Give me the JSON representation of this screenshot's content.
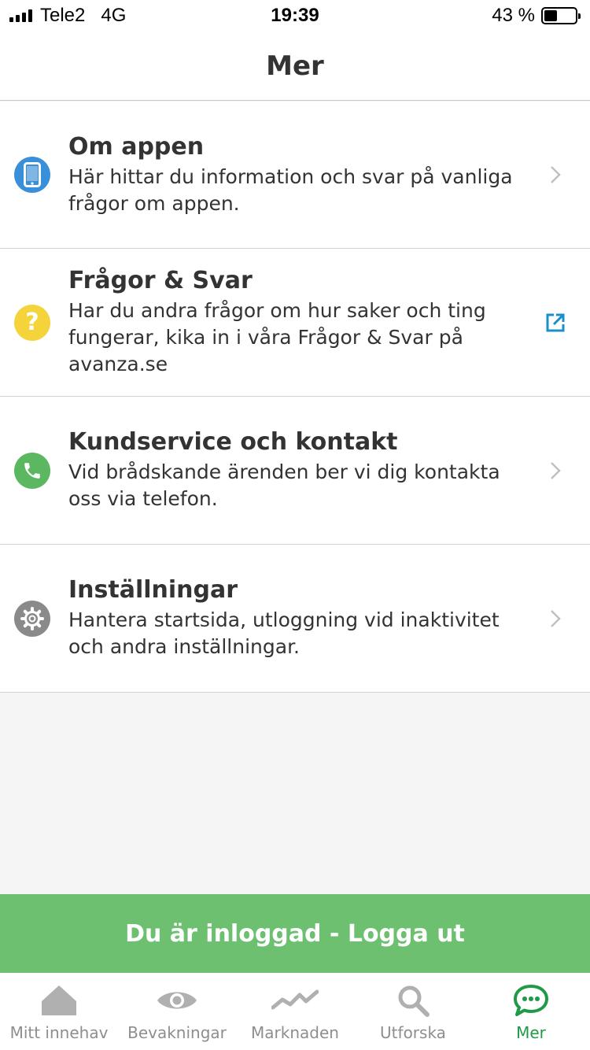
{
  "status_bar": {
    "carrier": "Tele2",
    "network": "4G",
    "time": "19:39",
    "battery_text": "43 %",
    "battery_level": 0.43
  },
  "header": {
    "title": "Mer"
  },
  "menu": {
    "items": [
      {
        "title": "Om appen",
        "description": "Här hittar du information och svar på vanliga frågor om appen.",
        "icon": "phone-device-icon",
        "icon_color": "#3a8fd9",
        "action": "chevron-right-icon"
      },
      {
        "title": "Frågor & Svar",
        "description": "Har du andra frågor om hur saker och ting fungerar, kika in i våra Frågor & Svar på avanza.se",
        "icon": "question-icon",
        "icon_color": "#f5d33b",
        "action": "external-link-icon"
      },
      {
        "title": "Kundservice och kontakt",
        "description": "Vid brådskande ärenden ber vi dig kontakta oss via telefon.",
        "icon": "phone-call-icon",
        "icon_color": "#5cb860",
        "action": "chevron-right-icon"
      },
      {
        "title": "Inställningar",
        "description": "Hantera startsida, utloggning vid inaktivitet och andra inställningar.",
        "icon": "gear-icon",
        "icon_color": "#8a8a8a",
        "action": "chevron-right-icon"
      }
    ]
  },
  "logout": {
    "label": "Du är inloggad - Logga ut",
    "color": "#6cc070"
  },
  "tab_bar": {
    "tabs": [
      {
        "label": "Mitt innehav",
        "icon": "home-icon"
      },
      {
        "label": "Bevakningar",
        "icon": "eye-icon"
      },
      {
        "label": "Marknaden",
        "icon": "trend-line-icon"
      },
      {
        "label": "Utforska",
        "icon": "search-icon"
      },
      {
        "label": "Mer",
        "icon": "chat-bubble-icon",
        "active": true
      }
    ],
    "active_color": "#1f9a47",
    "inactive_color": "#aaaaaa"
  }
}
